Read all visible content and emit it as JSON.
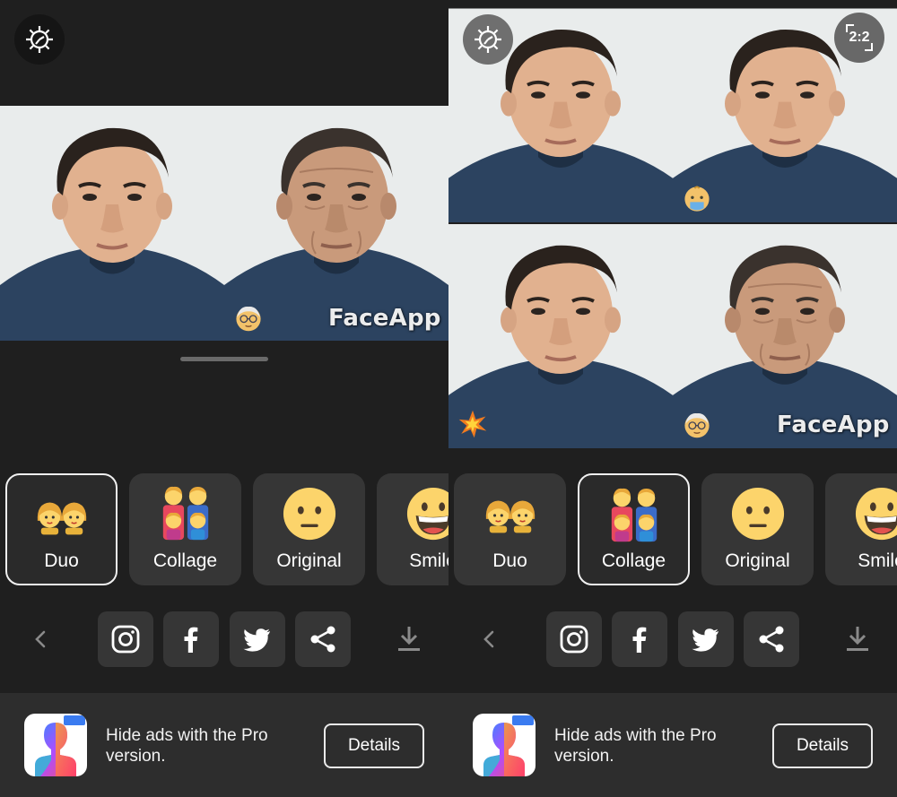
{
  "watermark": "FaceApp",
  "left_screen": {
    "filters": [
      {
        "label": "Duo",
        "icon": "two-faces-icon",
        "selected": true
      },
      {
        "label": "Collage",
        "icon": "family-icon",
        "selected": false
      },
      {
        "label": "Original",
        "icon": "neutral-face-icon",
        "selected": false
      },
      {
        "label": "Smile",
        "icon": "grinning-face-icon",
        "selected": false
      }
    ]
  },
  "right_screen": {
    "ratio_label": "2:2",
    "filters": [
      {
        "label": "Duo",
        "icon": "two-faces-icon",
        "selected": false
      },
      {
        "label": "Collage",
        "icon": "family-icon",
        "selected": true
      },
      {
        "label": "Original",
        "icon": "neutral-face-icon",
        "selected": false
      },
      {
        "label": "Smile",
        "icon": "grinning-face-icon",
        "selected": false
      }
    ]
  },
  "share_buttons": [
    "instagram-icon",
    "facebook-icon",
    "twitter-icon",
    "share-icon"
  ],
  "ad": {
    "badge": "PRO",
    "text": "Hide ads with the Pro version.",
    "button_label": "Details"
  },
  "colors": {
    "background": "#1f1f1f",
    "card": "#363636",
    "banner": "#2d2d2d",
    "shirt": "#2a3f58"
  }
}
